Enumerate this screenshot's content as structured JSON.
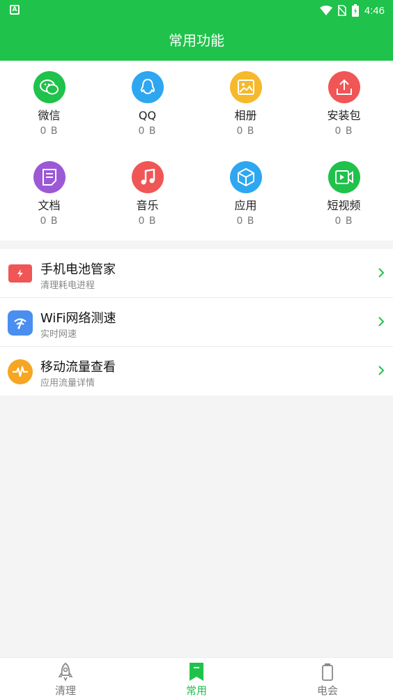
{
  "status": {
    "time": "4:46",
    "app_icon_letter": "A"
  },
  "header": {
    "title": "常用功能"
  },
  "grid": [
    {
      "label": "微信",
      "size": "0 B",
      "icon": "wechat-icon",
      "color": "#1fc24a"
    },
    {
      "label": "QQ",
      "size": "0 B",
      "icon": "qq-icon",
      "color": "#2ea7f0"
    },
    {
      "label": "相册",
      "size": "0 B",
      "icon": "photo-icon",
      "color": "#f6b92b"
    },
    {
      "label": "安装包",
      "size": "0 B",
      "icon": "upload-icon",
      "color": "#f05656"
    },
    {
      "label": "文档",
      "size": "0 B",
      "icon": "document-icon",
      "color": "#9b59d6"
    },
    {
      "label": "音乐",
      "size": "0 B",
      "icon": "music-icon",
      "color": "#f05656"
    },
    {
      "label": "应用",
      "size": "0 B",
      "icon": "cube-icon",
      "color": "#2ea7f0"
    },
    {
      "label": "短视频",
      "size": "0 B",
      "icon": "video-icon",
      "color": "#1fc24a"
    }
  ],
  "list": [
    {
      "title": "手机电池管家",
      "subtitle": "清理耗电进程",
      "icon": "battery-icon",
      "color": "#f05656"
    },
    {
      "title": "WiFi网络测速",
      "subtitle": "实时网速",
      "icon": "wifi-speed-icon",
      "color": "#4a8ef0"
    },
    {
      "title": "移动流量查看",
      "subtitle": "应用流量详情",
      "icon": "pulse-icon",
      "color": "#f6a623"
    }
  ],
  "nav": [
    {
      "label": "清理",
      "icon": "rocket-icon",
      "active": false
    },
    {
      "label": "常用",
      "icon": "bookmark-icon",
      "active": true
    },
    {
      "label": "电会",
      "icon": "battery-nav-icon",
      "active": false
    }
  ],
  "colors": {
    "brand": "#1fc24a",
    "inactive": "#777777"
  }
}
